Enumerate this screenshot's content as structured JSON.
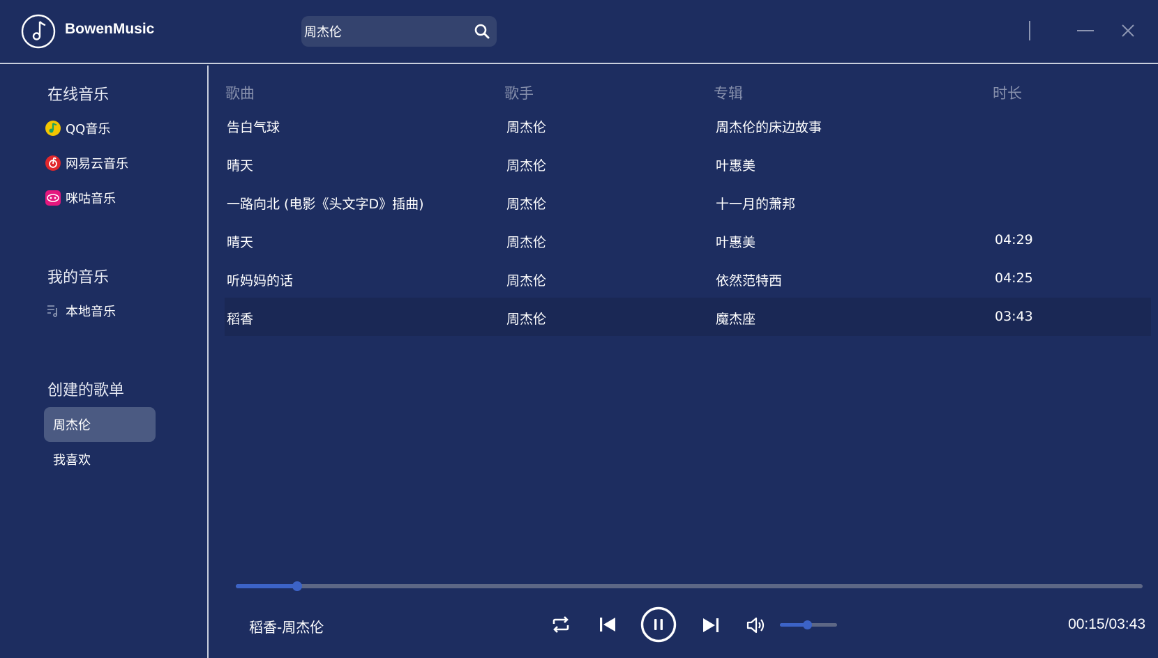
{
  "app": {
    "name": "BowenMusic"
  },
  "search": {
    "value": "周杰伦"
  },
  "sidebar": {
    "online_title": "在线音乐",
    "online_items": [
      {
        "label": "QQ音乐",
        "icon": "qq-music-icon",
        "color": "#f2c500"
      },
      {
        "label": "网易云音乐",
        "icon": "netease-music-icon",
        "color": "#e0272c"
      },
      {
        "label": "咪咕音乐",
        "icon": "migu-music-icon",
        "color": "#e5177e"
      }
    ],
    "my_title": "我的音乐",
    "my_items": [
      {
        "label": "本地音乐",
        "icon": "local-music-icon"
      }
    ],
    "playlist_title": "创建的歌单",
    "playlists": [
      {
        "label": "周杰伦",
        "active": true
      },
      {
        "label": "我喜欢",
        "active": false
      }
    ]
  },
  "table": {
    "headers": {
      "song": "歌曲",
      "artist": "歌手",
      "album": "专辑",
      "duration": "时长"
    },
    "rows": [
      {
        "song": "告白气球",
        "artist": "周杰伦",
        "album": "周杰伦的床边故事",
        "duration": ""
      },
      {
        "song": "晴天",
        "artist": "周杰伦",
        "album": "叶惠美",
        "duration": ""
      },
      {
        "song": "一路向北 (电影《头文字D》插曲)",
        "artist": "周杰伦",
        "album": "十一月的萧邦",
        "duration": ""
      },
      {
        "song": "晴天",
        "artist": "周杰伦",
        "album": "叶惠美",
        "duration": "04:29"
      },
      {
        "song": "听妈妈的话",
        "artist": "周杰伦",
        "album": "依然范特西",
        "duration": "04:25"
      },
      {
        "song": "稻香",
        "artist": "周杰伦",
        "album": "魔杰座",
        "duration": "03:43"
      }
    ],
    "selected_index": 5
  },
  "player": {
    "now_playing": "稻香-周杰伦",
    "time": "00:15/03:43",
    "progress_fraction": 0.068,
    "volume_fraction": 0.47,
    "state": "playing",
    "accent_color": "#3c63c7"
  }
}
